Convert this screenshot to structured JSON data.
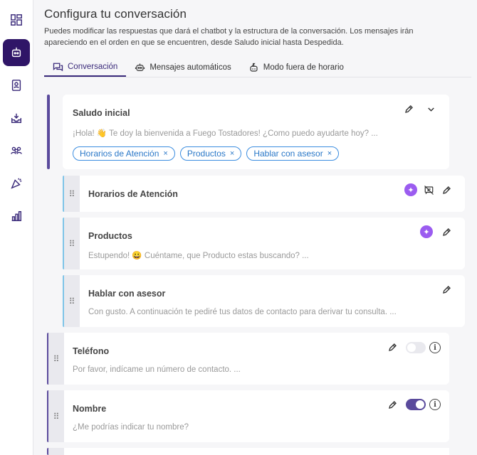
{
  "header": {
    "title": "Configura tu conversación",
    "description": "Puedes modificar las respuestas que dará el chatbot y la estructura de la conversación. Los mensajes irán apareciendo en el orden en que se encuentren, desde Saludo inicial hasta Despedida."
  },
  "sidebar": {
    "items": [
      {
        "icon": "dashboard-icon",
        "active": false
      },
      {
        "icon": "robot-icon",
        "active": true
      },
      {
        "icon": "contacts-book-icon",
        "active": false
      },
      {
        "icon": "inbox-icon",
        "active": false
      },
      {
        "icon": "users-icon",
        "active": false
      },
      {
        "icon": "campaign-icon",
        "active": false
      },
      {
        "icon": "bar-chart-icon",
        "active": false
      }
    ]
  },
  "tabs": [
    {
      "label": "Conversación",
      "icon": "chat-icon",
      "active": true
    },
    {
      "label": "Mensajes automáticos",
      "icon": "robot-icon",
      "active": false
    },
    {
      "label": "Modo fuera de horario",
      "icon": "sleep-robot-icon",
      "active": false
    }
  ],
  "saludo": {
    "title": "Saludo inicial",
    "message": "¡Hola! 👋 Te doy la bienvenida a Fuego Tostadores! ¿Como puedo ayudarte hoy? ...",
    "chips": [
      "Horarios de Atención",
      "Productos",
      "Hablar con asesor"
    ],
    "chip_remove": "×"
  },
  "options": [
    {
      "title": "Horarios de Atención",
      "message": ""
    },
    {
      "title": "Productos",
      "message": "Estupendo! 😀 Cuéntame, que Producto estas buscando? ..."
    },
    {
      "title": "Hablar con asesor",
      "message": "Con gusto. A continuación te pediré tus datos de contacto para derivar tu consulta. ..."
    }
  ],
  "fields": [
    {
      "title": "Teléfono",
      "message": "Por favor, indícame un número de contacto. ...",
      "toggle": "off"
    },
    {
      "title": "Nombre",
      "message": "¿Me podrías indicar tu nombre?",
      "toggle": "on"
    }
  ],
  "colors": {
    "accent": "#2f1567",
    "purple_bar": "#5a4a9c",
    "blue_bar": "#7fc4e8",
    "chip": "#3b8de0",
    "ai": "#9b5cf0"
  },
  "glyphs": {
    "drag": "⠿",
    "info": "i",
    "ai": "✦"
  }
}
